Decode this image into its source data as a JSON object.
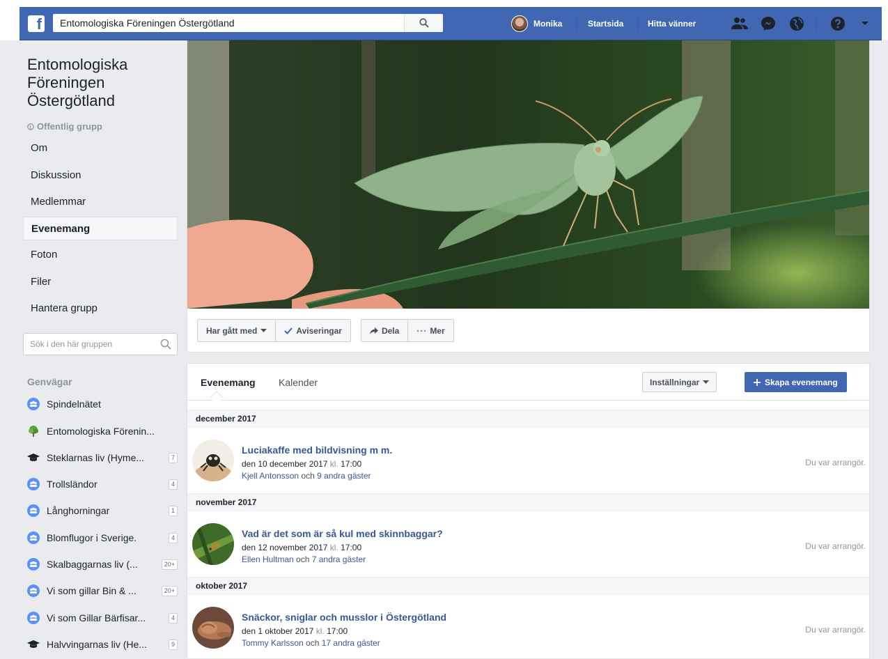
{
  "topbar": {
    "search_value": "Entomologiska Föreningen Östergötland",
    "user_name": "Monika",
    "home": "Startsida",
    "find_friends": "Hitta vänner"
  },
  "group": {
    "name": "Entomologiska Föreningen Östergötland",
    "privacy": "Offentlig grupp",
    "nav": [
      {
        "label": "Om"
      },
      {
        "label": "Diskussion"
      },
      {
        "label": "Medlemmar"
      },
      {
        "label": "Evenemang",
        "active": true
      },
      {
        "label": "Foton"
      },
      {
        "label": "Filer"
      },
      {
        "label": "Hantera grupp"
      }
    ],
    "search_placeholder": "Sök i den här gruppen"
  },
  "shortcuts": {
    "title": "Genvägar",
    "items": [
      {
        "label": "Spindelnätet",
        "icon": "group-icon",
        "count": ""
      },
      {
        "label": "Entomologiska Förenin...",
        "icon": "tree-icon",
        "count": ""
      },
      {
        "label": "Steklarnas liv (Hyme...",
        "icon": "graduation-cap-icon",
        "count": "7"
      },
      {
        "label": "Trollsländor",
        "icon": "group-icon",
        "count": "4"
      },
      {
        "label": "Långhorningar",
        "icon": "group-icon",
        "count": "1"
      },
      {
        "label": "Blomflugor i Sverige.",
        "icon": "group-icon",
        "count": "4"
      },
      {
        "label": "Skalbaggarnas liv (...",
        "icon": "group-icon",
        "count": "20+"
      },
      {
        "label": "Vi som gillar Bin & ...",
        "icon": "group-icon",
        "count": "20+"
      },
      {
        "label": "Vi som Gillar Bärfisar...",
        "icon": "group-icon",
        "count": "4"
      },
      {
        "label": "Halvvingarnas liv (He...",
        "icon": "graduation-cap-icon",
        "count": "9"
      }
    ]
  },
  "actions": {
    "joined": "Har gått med",
    "notifications": "Aviseringar",
    "share": "Dela",
    "more": "Mer"
  },
  "events": {
    "tabs": [
      "Evenemang",
      "Kalender"
    ],
    "settings": "Inställningar",
    "create": "Skapa evenemang",
    "kl": "kl.",
    "och": "och",
    "months": [
      {
        "label": "december 2017",
        "event": {
          "title": "Luciakaffe med bildvisning m m.",
          "date": "den 10 december 2017",
          "time": "17:00",
          "host": "Kjell Antonsson",
          "others": "9 andra gäster",
          "status": "Du var arrangör."
        }
      },
      {
        "label": "november 2017",
        "event": {
          "title": "Vad är det som är så kul med skinnbaggar?",
          "date": "den 12 november 2017",
          "time": "17:00",
          "host": "Ellen Hultman",
          "others": "7 andra gäster",
          "status": "Du var arrangör."
        }
      },
      {
        "label": "oktober 2017",
        "event": {
          "title": "Snäckor, sniglar och musslor i Östergötland",
          "date": "den 1 oktober 2017",
          "time": "17:00",
          "host": "Tommy Karlsson",
          "others": "17 andra gäster",
          "status": "Du var arrangör."
        }
      }
    ]
  }
}
